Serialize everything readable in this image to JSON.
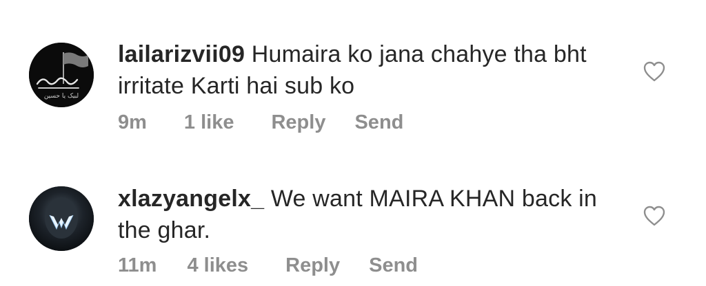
{
  "comments": [
    {
      "username": "lailarizvii09",
      "text": "Humaira ko jana chahye tha bht irritate Karti hai sub ko",
      "time": "9m",
      "likes": "1 like",
      "reply_label": "Reply",
      "send_label": "Send",
      "avatar_text": "لبیک یا حسین"
    },
    {
      "username": "xlazyangelx_",
      "text": "We want MAIRA KHAN back in the ghar.",
      "time": "11m",
      "likes": "4 likes",
      "reply_label": "Reply",
      "send_label": "Send"
    }
  ]
}
